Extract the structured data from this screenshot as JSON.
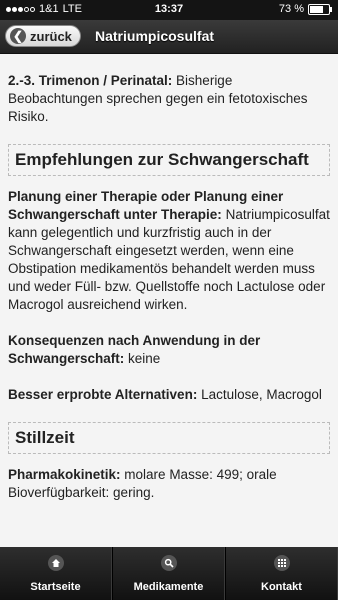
{
  "status": {
    "carrier": "1&1",
    "network": "LTE",
    "time": "13:37",
    "battery": "73 %",
    "battery_level": 0.73
  },
  "header": {
    "back_label": "zurück",
    "title": "Natriumpicosulfat"
  },
  "content": {
    "trimenon": {
      "label": "2.-3. Trimenon / Perinatal:",
      "text": " Bisherige Beobachtungen sprechen gegen ein fetotoxisches Risiko."
    },
    "section1_title": "Empfehlungen zur Schwangerschaft",
    "planung": {
      "label": "Planung einer Therapie oder Planung einer Schwangerschaft unter Therapie:",
      "text": " Natriumpicosulfat kann gelegentlich und kurzfristig auch in der Schwangerschaft eingesetzt werden, wenn eine Obstipation medikamentös behandelt werden muss und weder Füll- bzw. Quellstoffe noch Lactulose oder Macrogol ausreichend wirken."
    },
    "konsequenzen": {
      "label": "Konsequenzen nach Anwendung in der Schwangerschaft:",
      "text": " keine"
    },
    "alternativen": {
      "label": "Besser erprobte Alternativen:",
      "text": " Lactulose, Macrogol"
    },
    "section2_title": "Stillzeit",
    "pharmako": {
      "label": "Pharmakokinetik:",
      "text": " molare Masse: 499; orale Bioverfügbarkeit: gering."
    }
  },
  "nav": {
    "items": [
      {
        "label": "Startseite",
        "icon": "home-icon"
      },
      {
        "label": "Medikamente",
        "icon": "search-icon"
      },
      {
        "label": "Kontakt",
        "icon": "grid-icon"
      }
    ]
  }
}
